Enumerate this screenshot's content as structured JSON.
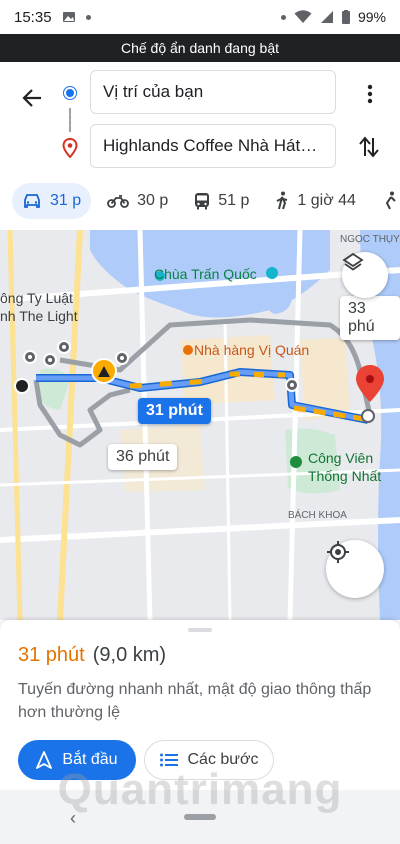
{
  "status_bar": {
    "time": "15:35",
    "battery": "99%"
  },
  "incognito_banner": "Chế độ ẩn danh đang bật",
  "directions": {
    "origin": "Vị trí của bạn",
    "destination": "Highlands Coffee Nhà Hát…"
  },
  "travel_modes": [
    {
      "label": "31 p",
      "icon": "car-icon",
      "active": true
    },
    {
      "label": "30 p",
      "icon": "motorbike-icon"
    },
    {
      "label": "51 p",
      "icon": "bus-icon"
    },
    {
      "label": "1 giờ 44",
      "icon": "walk-icon"
    }
  ],
  "map": {
    "pois": {
      "ngoc_thuy": "NGỌC THỤY",
      "chua_tran_quoc": "Chùa Trấn Quốc",
      "cong_ty_luat_1": "ông Ty Luật",
      "cong_ty_luat_2": "nh The Light",
      "nha_hang": "Nhà hàng Vị Quán",
      "cong_vien_1": "Công Viên",
      "cong_vien_2": "Thống Nhất",
      "bach_khoa": "BÁCH KHOA"
    },
    "route_badges": {
      "selected": "31 phút",
      "alt_1": "36 phút",
      "alt_2": "33 phú"
    }
  },
  "sheet": {
    "duration": "31 phút",
    "distance": "(9,0 km)",
    "description": "Tuyến đường nhanh nhất, mật độ giao thông thấp hơn thường lệ",
    "start_label": "Bắt đầu",
    "steps_label": "Các bước"
  },
  "watermark": "Quantrimang",
  "colors": {
    "accent": "#1a73e8",
    "orange": "#e37400",
    "route": "#4285f4",
    "pin": "#ea4335"
  }
}
